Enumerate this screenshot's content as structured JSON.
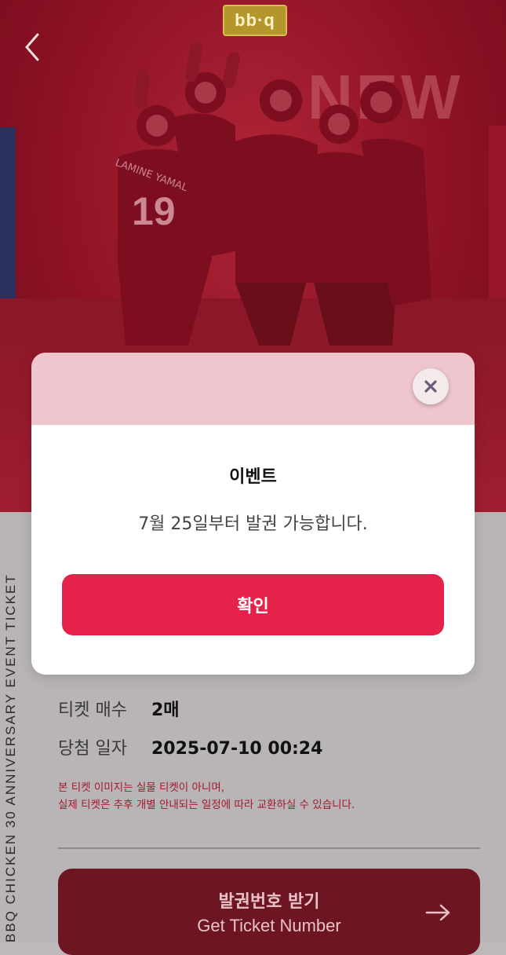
{
  "brand": {
    "logo_text": "bb·q"
  },
  "hero": {
    "banner_text": "NEW",
    "player_number": "19",
    "player_name": "LAMINE YAMAL"
  },
  "side_label": "BBQ CHICKEN 30 ANNIVERSARY EVENT TICKET",
  "ticket_info": {
    "rows": [
      {
        "label": "티켓 매수",
        "value": "2매"
      },
      {
        "label": "당첨 일자",
        "value": "2025-07-10 00:24"
      }
    ]
  },
  "notice": {
    "line1": "본 티켓 이미지는 실물 티켓이 아니며,",
    "line2": "실제 티켓은 추후 개별 안내되는 일정에 따라 교환하실 수 있습니다."
  },
  "ticket_button": {
    "label_ko": "발권번호 받기",
    "label_en": "Get Ticket Number"
  },
  "modal": {
    "title": "이벤트",
    "message": "7월 25일부터 발권 가능합니다.",
    "confirm_label": "확인"
  },
  "colors": {
    "accent": "#e5234a",
    "hero": "#8f1427",
    "button_dark": "#6e1522"
  }
}
